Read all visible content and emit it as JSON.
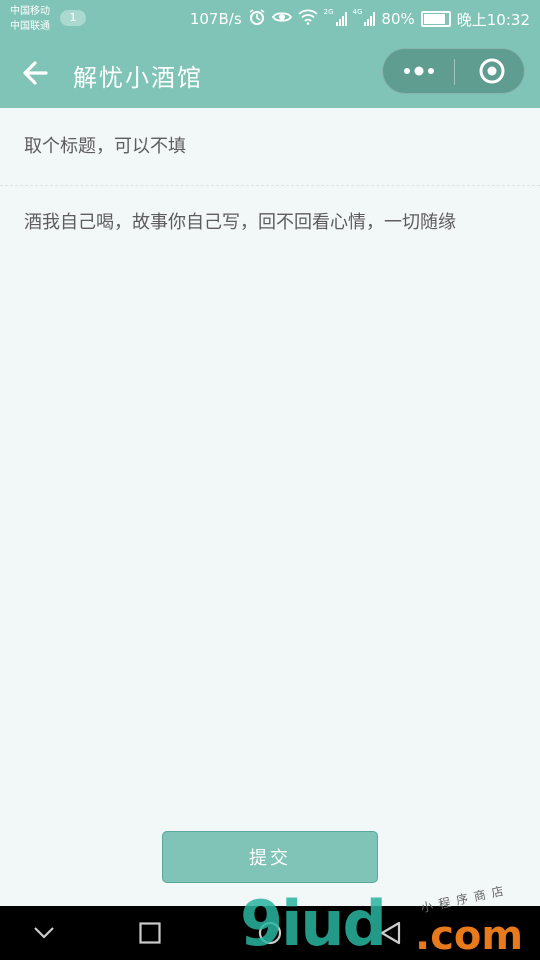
{
  "status_bar": {
    "carrier_1": "中国移动",
    "carrier_2": "中国联通",
    "badge": "1",
    "speed": "107B/s",
    "net_2g": "2G",
    "net_4g": "4G",
    "battery": "80%",
    "time": "晚上10:32"
  },
  "nav": {
    "title": "解忧小酒馆"
  },
  "form": {
    "title_placeholder": "取个标题，可以不填",
    "content_placeholder": "酒我自己喝，故事你自己写，回不回看心情，一切随缘",
    "submit_label": "提交"
  },
  "watermark": {
    "big": "9iud",
    "com": ".com",
    "small": "小程序商店"
  },
  "colors": {
    "accent": "#7fc4b6",
    "background": "#f2f7f8",
    "text": "#5d5d5d"
  }
}
